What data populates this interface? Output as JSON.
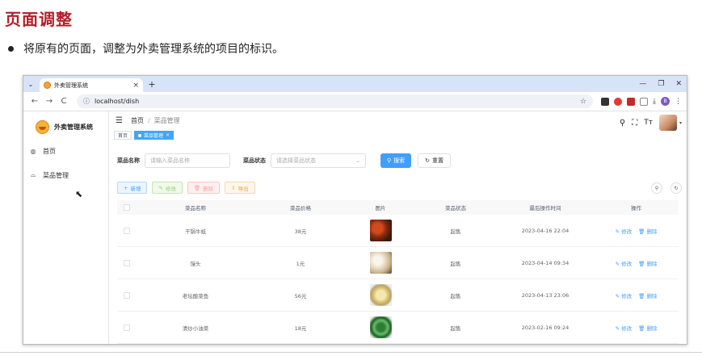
{
  "slide": {
    "title": "页面调整",
    "bullet": "将原有的页面，调整为外卖管理系统的项目的标识。"
  },
  "browser": {
    "tab_title": "外卖管理系统",
    "url": "localhost/dish",
    "tab_menu_glyph": "⌄",
    "close_glyph": "×",
    "new_tab_glyph": "+",
    "minimize_glyph": "—",
    "restore_glyph": "❐",
    "window_close_glyph": "✕",
    "back_glyph": "←",
    "forward_glyph": "→",
    "reload_glyph": "C",
    "info_glyph": "ⓘ",
    "star_glyph": "☆",
    "download_glyph": "⤓",
    "profile_initial": "B",
    "more_glyph": "⋮"
  },
  "sidebar": {
    "brand_name": "外卖管理系统",
    "items": [
      {
        "label": "首页",
        "icon": "dashboard-icon",
        "glyph": "◍"
      },
      {
        "label": "菜品管理",
        "icon": "dish-icon",
        "glyph": "⌓"
      }
    ],
    "cursor_glyph": "⬉"
  },
  "header": {
    "menu_glyph": "☰",
    "breadcrumb": [
      "首页",
      "菜品管理"
    ],
    "breadcrumb_sep": "/",
    "search_glyph": "⚲",
    "fullscreen_glyph": "⛶",
    "fontsize_glyph": "Tт",
    "caret_glyph": "▾"
  },
  "tags": {
    "home": "首页",
    "current": "菜品管理",
    "close": "×"
  },
  "search": {
    "name_label": "菜品名称",
    "name_placeholder": "请输入菜品名称",
    "status_label": "菜品状态",
    "status_placeholder": "请选择菜品状态",
    "status_caret": "⌄",
    "search_button": "搜索",
    "search_glyph": "⚲",
    "reset_button": "重置",
    "reset_glyph": "↻"
  },
  "actions": {
    "add": "新增",
    "add_glyph": "+",
    "edit": "修改",
    "edit_glyph": "✎",
    "delete": "删除",
    "delete_glyph": "🗑",
    "export": "导出",
    "export_glyph": "⇩",
    "search_toggle_glyph": "⚲",
    "refresh_glyph": "↻"
  },
  "table": {
    "headers": [
      "菜品名称",
      "菜品价格",
      "图片",
      "菜品状态",
      "最后操作时间",
      "操作"
    ],
    "rows": [
      {
        "name": "干锅牛蛙",
        "price": "38元",
        "status": "起售",
        "time": "2023-04-16 22:04",
        "image": "thumb-0"
      },
      {
        "name": "馒头",
        "price": "1元",
        "status": "起售",
        "time": "2023-04-14 09:34",
        "image": "thumb-1"
      },
      {
        "name": "老坛酸菜鱼",
        "price": "56元",
        "status": "起售",
        "time": "2023-04-13 23:06",
        "image": "thumb-2"
      },
      {
        "name": "清炒小油菜",
        "price": "18元",
        "status": "起售",
        "time": "2023-02-16 09:24",
        "image": "thumb-3"
      }
    ],
    "edit_label": "修改",
    "edit_glyph": "✎",
    "delete_label": "删除",
    "delete_glyph": "🗑"
  },
  "colors": {
    "title_red": "#b3202a",
    "primary_blue": "#409eff",
    "tag_active": "#42a5f5"
  }
}
